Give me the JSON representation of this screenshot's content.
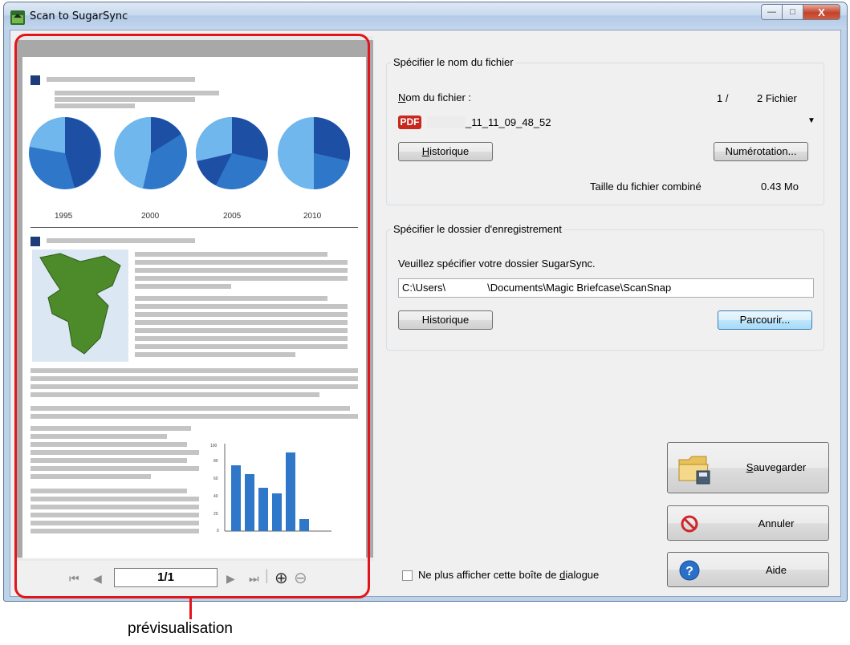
{
  "window": {
    "title": "Scan to SugarSync",
    "min_symbol": "—",
    "max_symbol": "□",
    "close_symbol": "X"
  },
  "preview": {
    "page_indicator": "1/1",
    "years": [
      "1995",
      "2000",
      "2005",
      "2010"
    ],
    "nav_first": "⏮",
    "nav_prev": "◀",
    "nav_next": "▶",
    "nav_last": "⏭",
    "zoom_in": "⊕",
    "zoom_out": "⊖",
    "chart_axis_labels": [
      "100",
      "80",
      "60",
      "40",
      "20",
      "0"
    ],
    "annotation": "prévisualisation"
  },
  "file_group": {
    "legend": "Spécifier le nom du fichier",
    "filename_label_key": "N",
    "filename_label_rest": "om du fichier :",
    "counter": "1 /",
    "counter_total": "2 Fichier",
    "pdf_badge": "PDF",
    "filename_value": "_11_11_09_48_52",
    "history_key": "H",
    "history_rest": "istorique",
    "numbering_button": "Numérotation...",
    "combined_size_label": "Taille du fichier combiné",
    "combined_size_value": "0.43  Mo"
  },
  "folder_group": {
    "legend": "Spécifier le dossier d'enregistrement",
    "instruction": "Veuillez spécifier votre dossier SugarSync.",
    "path_start": "C:\\Users\\",
    "path_end": "\\Documents\\Magic Briefcase\\ScanSnap",
    "history_button": "Historique",
    "browse_button": "Parcourir..."
  },
  "actions": {
    "save": "Sauvegarder",
    "cancel": "Annuler",
    "help": "Aide",
    "dont_show_again": "Ne plus afficher cette boîte de dialogue"
  }
}
